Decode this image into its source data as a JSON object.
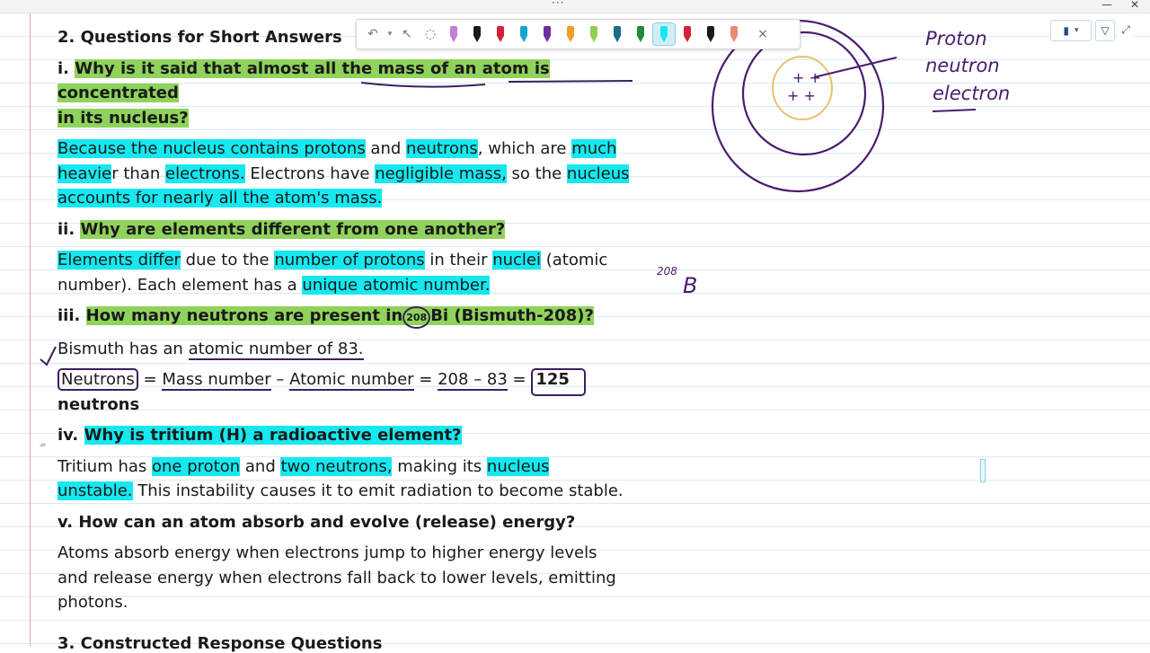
{
  "toolbar": {
    "tools": [
      "undo-icon",
      "dropdown-icon",
      "select-icon",
      "lasso-icon"
    ],
    "pens": [
      "#c27ed6",
      "#1a1a1a",
      "#d6203a",
      "#13a6cf",
      "#6b2ea3",
      "#f0a020",
      "#8ed14c",
      "#1b6b8a",
      "#1e8a3a",
      "#16e8f0",
      "#d6203a",
      "#1a1a1a",
      "#e88a7a"
    ],
    "close_icon": "×"
  },
  "content": {
    "section_title": "2. Questions for Short Answers",
    "q1_num": "i.",
    "q1_a": "Why is it said that almost all the mass of an atom is concentrated",
    "q1_b": "in its nucleus?",
    "a1_1": "Because the nucleus contains protons",
    "a1_2": " and ",
    "a1_3": "neutrons",
    "a1_4": ", which are ",
    "a1_5": "much",
    "a1_6": "heavie",
    "a1_7": "r than ",
    "a1_8": "electrons.",
    "a1_9": " Electrons have ",
    "a1_10": "negligible mass,",
    "a1_11": " so the ",
    "a1_12": "nucleus",
    "a1_13": "accounts for nearly all the atom's mass.",
    "q2_num": "ii.",
    "q2": "Why are elements different from one another?",
    "a2_1": "Elements differ",
    "a2_2": " due to the ",
    "a2_3": "number of protons",
    "a2_4": " in their ",
    "a2_5": "nuclei",
    "a2_6": " (atomic",
    "a2_7": "number). Each element has a ",
    "a2_8": "unique atomic number.",
    "q3_num": "iii.",
    "q3_a": "How many neutrons are present in",
    "q3_sup": "208",
    "q3_b": "Bi (Bismuth-208)?",
    "a3_1": "Bismuth has an ",
    "a3_2": "atomic number of 83.",
    "a3_3": "Neutrons",
    "a3_4": " = ",
    "a3_5": "Mass number",
    "a3_6": " – ",
    "a3_7": "Atomic number",
    "a3_8": " = ",
    "a3_9": "208 – 83",
    "a3_10": " = ",
    "a3_11": "125",
    "a3_12": "neutrons",
    "q4_num": "iv.",
    "q4": "Why is tritium (H) a radioactive element?",
    "a4_1": "Tritium has ",
    "a4_2": "one proton",
    "a4_3": " and ",
    "a4_4": "two neutrons,",
    "a4_5": " making its ",
    "a4_6": "nucleus",
    "a4_7": "unstable.",
    "a4_8": " This instability causes it to emit radiation to become stable.",
    "q5": "v. How can an atom absorb and evolve (release) energy?",
    "a5_1": "Atoms absorb energy when electrons jump to higher energy levels",
    "a5_2": "and release energy when electrons fall back to lower levels, emitting",
    "a5_3": "photons.",
    "next_section": "3. Constructed Response Questions"
  },
  "ink": {
    "label1": "Proton",
    "label2": "neutron",
    "label3": "electron",
    "note_number": "208",
    "note_symbol": "B",
    "nucleus_marks": "+ +"
  },
  "colors": {
    "highlight_green": "#8fd35c",
    "highlight_cyan": "#16e8f0",
    "ink_purple": "#4a1c6e",
    "ink_yellow": "#e6c26a"
  }
}
